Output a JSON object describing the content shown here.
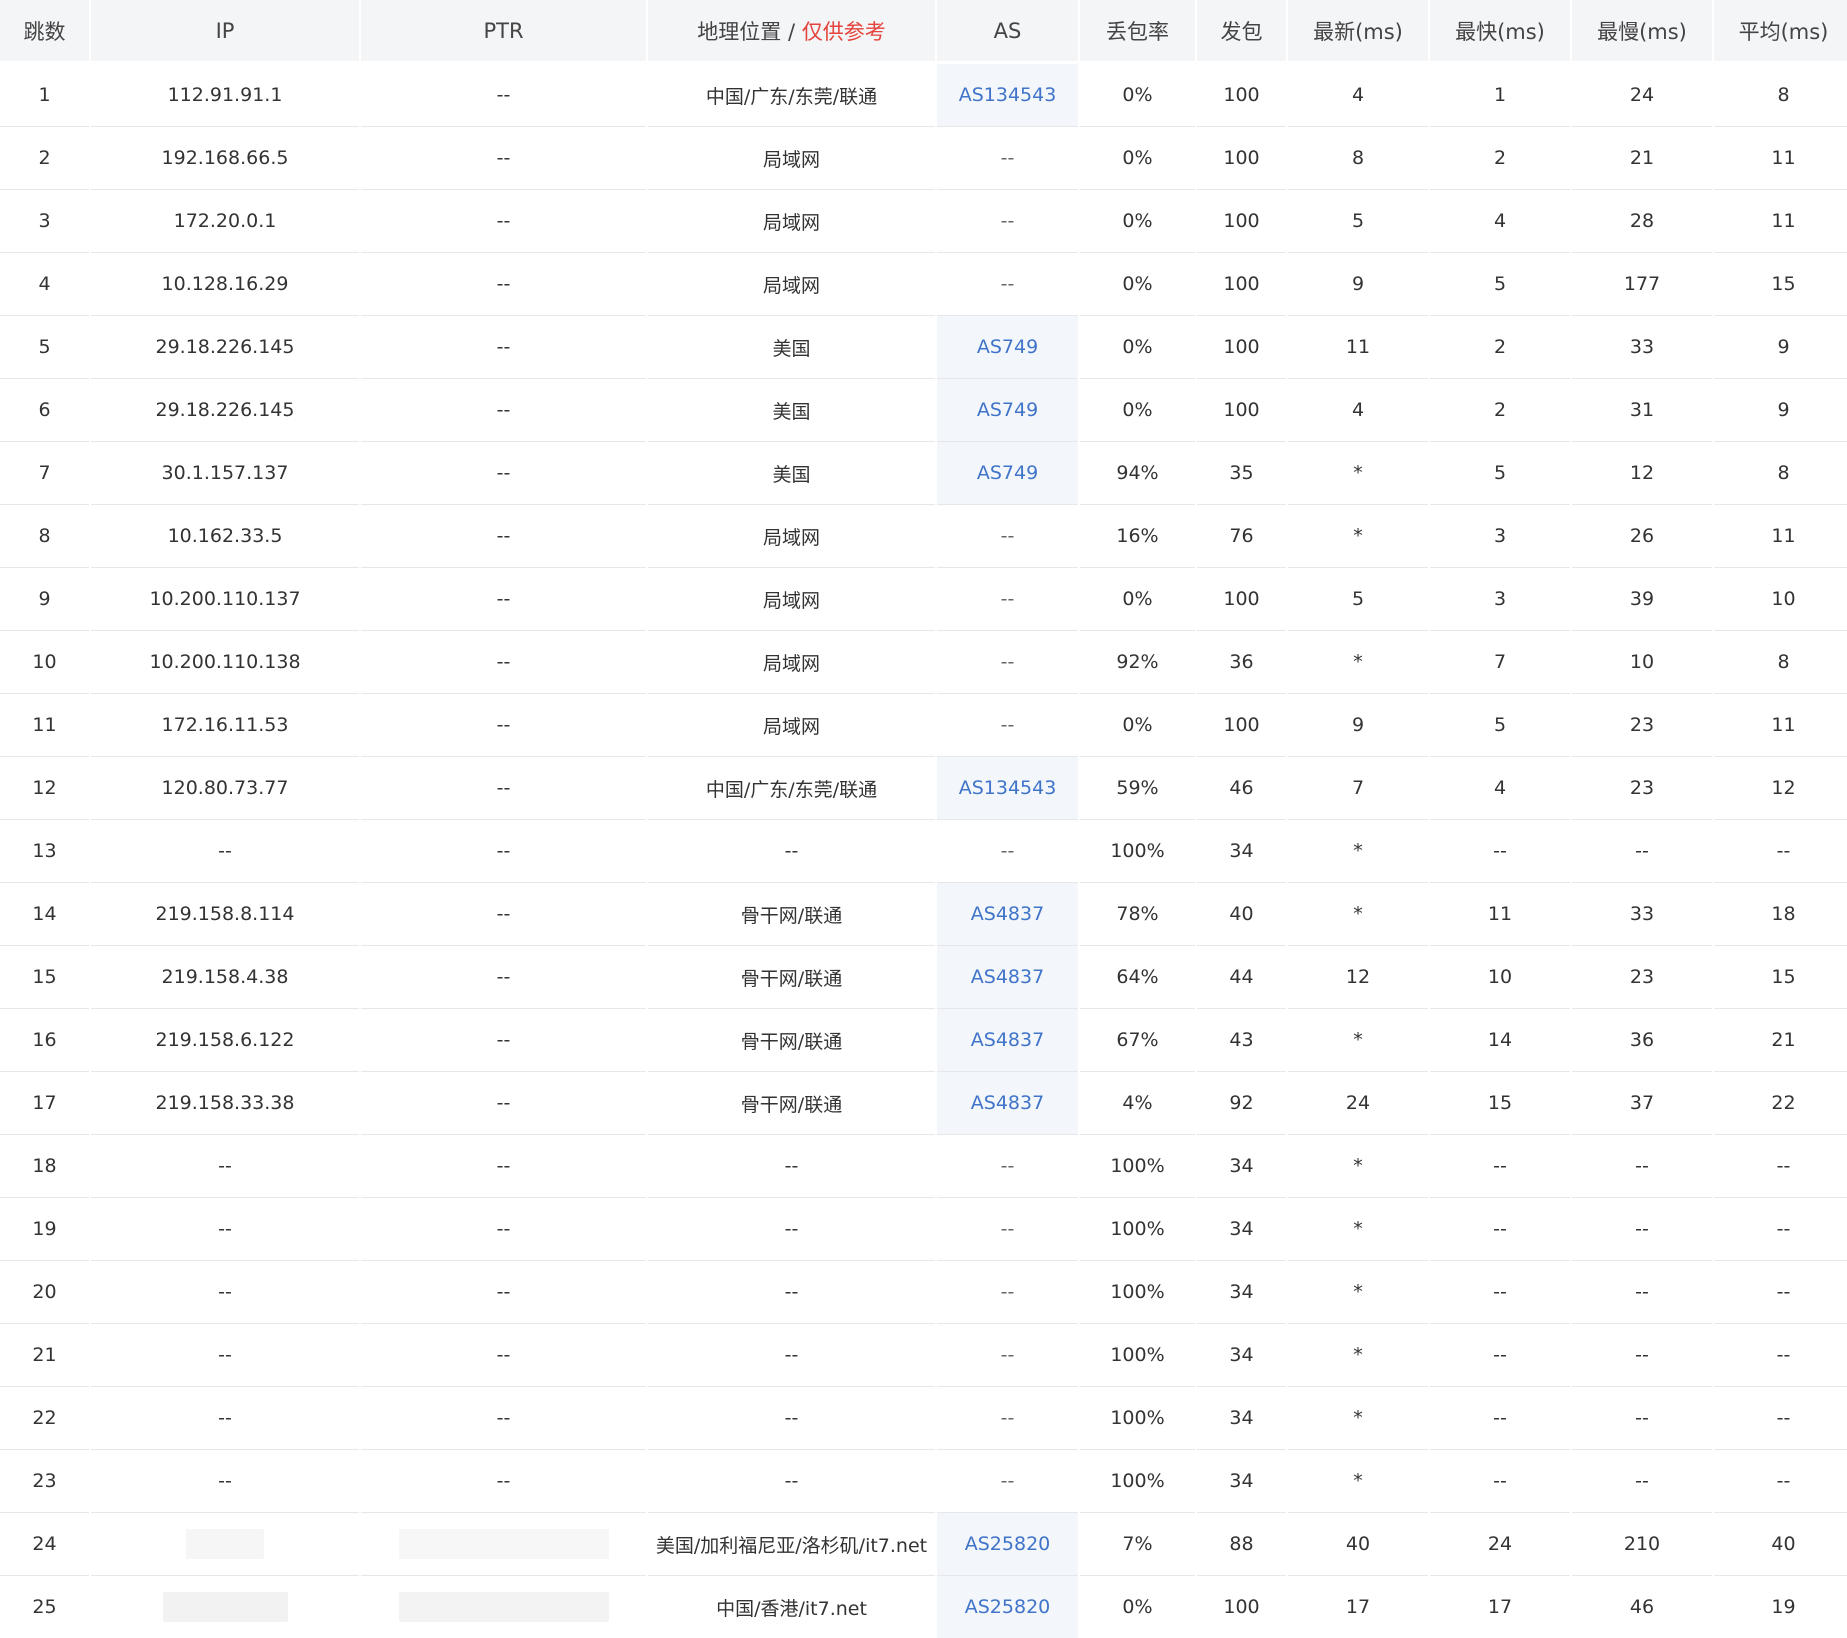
{
  "headers": {
    "hop": "跳数",
    "ip": "IP",
    "ptr": "PTR",
    "geo_main": "地理位置 / ",
    "geo_note": "仅供参考",
    "as": "AS",
    "loss": "丢包率",
    "sent": "发包",
    "last": "最新(ms)",
    "best": "最快(ms)",
    "worst": "最慢(ms)",
    "avg": "平均(ms)"
  },
  "colors": {
    "as_link": "#3f74c9",
    "geo_note": "#e4433b",
    "header_bg": "#f4f5f7",
    "as_cell_bg": "#f3f6fa"
  },
  "rows": [
    {
      "hop": "1",
      "ip": "112.91.91.1",
      "ptr": "--",
      "geo": "中国/广东/东莞/联通",
      "as": "AS134543",
      "as_link": true,
      "loss": "0%",
      "sent": "100",
      "last": "4",
      "best": "1",
      "worst": "24",
      "avg": "8"
    },
    {
      "hop": "2",
      "ip": "192.168.66.5",
      "ptr": "--",
      "geo": "局域网",
      "as": "--",
      "as_link": false,
      "loss": "0%",
      "sent": "100",
      "last": "8",
      "best": "2",
      "worst": "21",
      "avg": "11"
    },
    {
      "hop": "3",
      "ip": "172.20.0.1",
      "ptr": "--",
      "geo": "局域网",
      "as": "--",
      "as_link": false,
      "loss": "0%",
      "sent": "100",
      "last": "5",
      "best": "4",
      "worst": "28",
      "avg": "11"
    },
    {
      "hop": "4",
      "ip": "10.128.16.29",
      "ptr": "--",
      "geo": "局域网",
      "as": "--",
      "as_link": false,
      "loss": "0%",
      "sent": "100",
      "last": "9",
      "best": "5",
      "worst": "177",
      "avg": "15"
    },
    {
      "hop": "5",
      "ip": "29.18.226.145",
      "ptr": "--",
      "geo": "美国",
      "as": "AS749",
      "as_link": true,
      "loss": "0%",
      "sent": "100",
      "last": "11",
      "best": "2",
      "worst": "33",
      "avg": "9"
    },
    {
      "hop": "6",
      "ip": "29.18.226.145",
      "ptr": "--",
      "geo": "美国",
      "as": "AS749",
      "as_link": true,
      "loss": "0%",
      "sent": "100",
      "last": "4",
      "best": "2",
      "worst": "31",
      "avg": "9"
    },
    {
      "hop": "7",
      "ip": "30.1.157.137",
      "ptr": "--",
      "geo": "美国",
      "as": "AS749",
      "as_link": true,
      "loss": "94%",
      "sent": "35",
      "last": "*",
      "best": "5",
      "worst": "12",
      "avg": "8"
    },
    {
      "hop": "8",
      "ip": "10.162.33.5",
      "ptr": "--",
      "geo": "局域网",
      "as": "--",
      "as_link": false,
      "loss": "16%",
      "sent": "76",
      "last": "*",
      "best": "3",
      "worst": "26",
      "avg": "11"
    },
    {
      "hop": "9",
      "ip": "10.200.110.137",
      "ptr": "--",
      "geo": "局域网",
      "as": "--",
      "as_link": false,
      "loss": "0%",
      "sent": "100",
      "last": "5",
      "best": "3",
      "worst": "39",
      "avg": "10"
    },
    {
      "hop": "10",
      "ip": "10.200.110.138",
      "ptr": "--",
      "geo": "局域网",
      "as": "--",
      "as_link": false,
      "loss": "92%",
      "sent": "36",
      "last": "*",
      "best": "7",
      "worst": "10",
      "avg": "8"
    },
    {
      "hop": "11",
      "ip": "172.16.11.53",
      "ptr": "--",
      "geo": "局域网",
      "as": "--",
      "as_link": false,
      "loss": "0%",
      "sent": "100",
      "last": "9",
      "best": "5",
      "worst": "23",
      "avg": "11"
    },
    {
      "hop": "12",
      "ip": "120.80.73.77",
      "ptr": "--",
      "geo": "中国/广东/东莞/联通",
      "as": "AS134543",
      "as_link": true,
      "loss": "59%",
      "sent": "46",
      "last": "7",
      "best": "4",
      "worst": "23",
      "avg": "12"
    },
    {
      "hop": "13",
      "ip": "--",
      "ptr": "--",
      "geo": "--",
      "as": "--",
      "as_link": false,
      "loss": "100%",
      "sent": "34",
      "last": "*",
      "best": "--",
      "worst": "--",
      "avg": "--"
    },
    {
      "hop": "14",
      "ip": "219.158.8.114",
      "ptr": "--",
      "geo": "骨干网/联通",
      "as": "AS4837",
      "as_link": true,
      "loss": "78%",
      "sent": "40",
      "last": "*",
      "best": "11",
      "worst": "33",
      "avg": "18"
    },
    {
      "hop": "15",
      "ip": "219.158.4.38",
      "ptr": "--",
      "geo": "骨干网/联通",
      "as": "AS4837",
      "as_link": true,
      "loss": "64%",
      "sent": "44",
      "last": "12",
      "best": "10",
      "worst": "23",
      "avg": "15"
    },
    {
      "hop": "16",
      "ip": "219.158.6.122",
      "ptr": "--",
      "geo": "骨干网/联通",
      "as": "AS4837",
      "as_link": true,
      "loss": "67%",
      "sent": "43",
      "last": "*",
      "best": "14",
      "worst": "36",
      "avg": "21"
    },
    {
      "hop": "17",
      "ip": "219.158.33.38",
      "ptr": "--",
      "geo": "骨干网/联通",
      "as": "AS4837",
      "as_link": true,
      "loss": "4%",
      "sent": "92",
      "last": "24",
      "best": "15",
      "worst": "37",
      "avg": "22"
    },
    {
      "hop": "18",
      "ip": "--",
      "ptr": "--",
      "geo": "--",
      "as": "--",
      "as_link": false,
      "loss": "100%",
      "sent": "34",
      "last": "*",
      "best": "--",
      "worst": "--",
      "avg": "--"
    },
    {
      "hop": "19",
      "ip": "--",
      "ptr": "--",
      "geo": "--",
      "as": "--",
      "as_link": false,
      "loss": "100%",
      "sent": "34",
      "last": "*",
      "best": "--",
      "worst": "--",
      "avg": "--"
    },
    {
      "hop": "20",
      "ip": "--",
      "ptr": "--",
      "geo": "--",
      "as": "--",
      "as_link": false,
      "loss": "100%",
      "sent": "34",
      "last": "*",
      "best": "--",
      "worst": "--",
      "avg": "--"
    },
    {
      "hop": "21",
      "ip": "--",
      "ptr": "--",
      "geo": "--",
      "as": "--",
      "as_link": false,
      "loss": "100%",
      "sent": "34",
      "last": "*",
      "best": "--",
      "worst": "--",
      "avg": "--"
    },
    {
      "hop": "22",
      "ip": "--",
      "ptr": "--",
      "geo": "--",
      "as": "--",
      "as_link": false,
      "loss": "100%",
      "sent": "34",
      "last": "*",
      "best": "--",
      "worst": "--",
      "avg": "--"
    },
    {
      "hop": "23",
      "ip": "--",
      "ptr": "--",
      "geo": "--",
      "as": "--",
      "as_link": false,
      "loss": "100%",
      "sent": "34",
      "last": "*",
      "best": "--",
      "worst": "--",
      "avg": "--"
    },
    {
      "hop": "24",
      "ip": "",
      "ptr": "",
      "geo": "美国/加利福尼亚/洛杉矶/it7.net",
      "as": "AS25820",
      "as_link": true,
      "loss": "7%",
      "sent": "88",
      "last": "40",
      "best": "24",
      "worst": "210",
      "avg": "40"
    },
    {
      "hop": "25",
      "ip": "",
      "ptr": "",
      "geo": "中国/香港/it7.net",
      "as": "AS25820",
      "as_link": true,
      "loss": "0%",
      "sent": "100",
      "last": "17",
      "best": "17",
      "worst": "46",
      "avg": "19"
    }
  ]
}
